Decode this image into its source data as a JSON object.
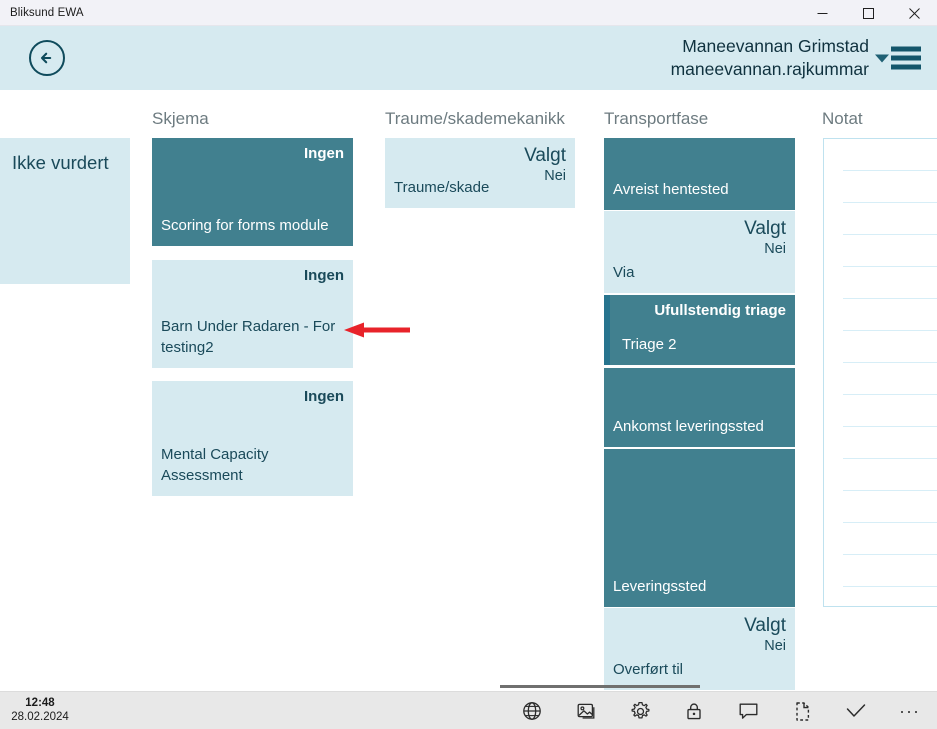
{
  "window": {
    "title": "Bliksund EWA",
    "minimize_label": "minimize",
    "maximize_label": "maximize",
    "close_label": "close"
  },
  "header": {
    "back_label": "back-arrow",
    "user_name": "Maneevannan Grimstad",
    "user_login": "maneevannan.rajkummar",
    "caret_label": "chevron-down",
    "menu_label": "menu"
  },
  "board": {
    "unassessed": {
      "label": "Ikke vurdert"
    },
    "columns": [
      {
        "id": "skjema",
        "title": "Skjema",
        "cards": [
          {
            "status": "Ingen",
            "substatus": "",
            "title": "Scoring for forms module",
            "variant": "dark"
          },
          {
            "status": "Ingen",
            "substatus": "",
            "title": "Barn Under Radaren - For testing2",
            "variant": "light"
          },
          {
            "status": "Ingen",
            "substatus": "",
            "title": "Mental Capacity Assessment",
            "variant": "light"
          }
        ]
      },
      {
        "id": "traume",
        "title": "Traume/skademekanikk",
        "cards": [
          {
            "status": "Valgt",
            "substatus": "Nei",
            "title": "Traume/skade",
            "variant": "light"
          }
        ]
      },
      {
        "id": "transportfase",
        "title": "Transportfase",
        "cards": [
          {
            "status": "",
            "substatus": "",
            "title": "Avreist hentested",
            "variant": "dark"
          },
          {
            "status": "Valgt",
            "substatus": "Nei",
            "title": "Via",
            "variant": "light"
          },
          {
            "status": "Ufullstendig triage",
            "substatus": "",
            "title": "Triage 2",
            "variant": "dark-accent"
          },
          {
            "status": "",
            "substatus": "",
            "title": "Ankomst leveringssted",
            "variant": "dark"
          },
          {
            "status": "",
            "substatus": "",
            "title": "Leveringssted",
            "variant": "dark"
          },
          {
            "status": "Valgt",
            "substatus": "Nei",
            "title": "Overført til",
            "variant": "light"
          }
        ]
      },
      {
        "id": "notat",
        "title": "Notat",
        "cards": []
      }
    ]
  },
  "annotation": {
    "arrow_label": "red-pointer-arrow",
    "color": "#e8232a"
  },
  "statusbar": {
    "time": "12:48",
    "date": "28.02.2024",
    "icons": [
      {
        "name": "globe-icon",
        "title": "Language"
      },
      {
        "name": "image-icon",
        "title": "Images"
      },
      {
        "name": "gear-icon",
        "title": "Settings"
      },
      {
        "name": "lock-icon",
        "title": "Lock"
      },
      {
        "name": "comment-icon",
        "title": "Comment"
      },
      {
        "name": "document-dashed-icon",
        "title": "Draft"
      },
      {
        "name": "check-icon",
        "title": "Confirm"
      },
      {
        "name": "more-icon",
        "title": "More"
      }
    ],
    "more_glyph": "..."
  },
  "theme": {
    "teal_dark": "#41808f",
    "teal_light": "#d6eaf0",
    "text_dark": "#1a4a5a",
    "accent_bar": "#27748e",
    "arrow_red": "#e8232a"
  }
}
